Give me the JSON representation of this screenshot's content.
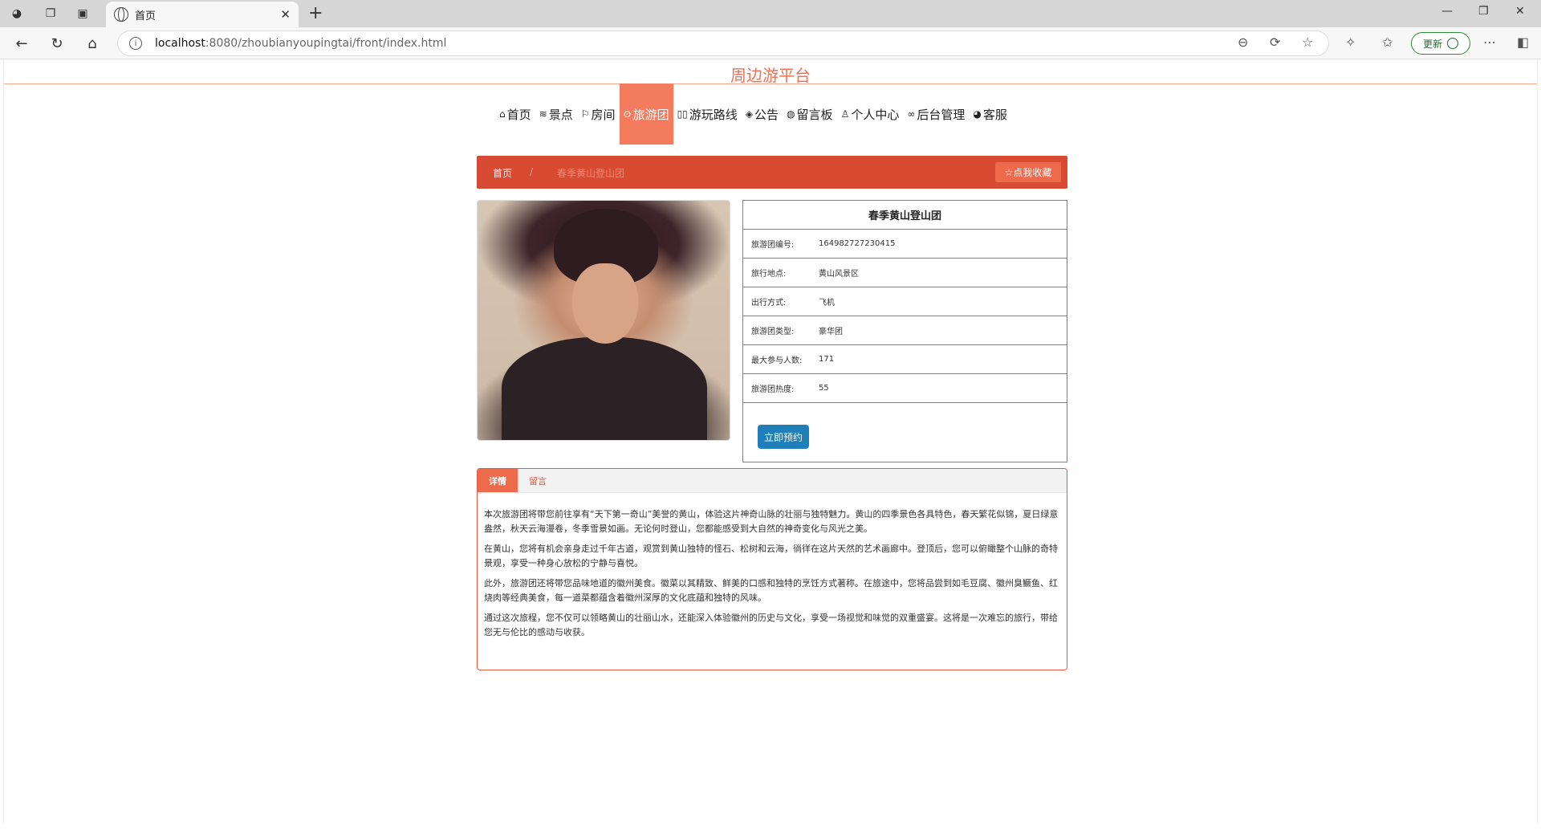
{
  "browser": {
    "tab_title": "首页",
    "url_host": "localhost",
    "url_rest": ":8080/zhoubianyoupingtai/front/index.html",
    "update_label": "更新"
  },
  "site": {
    "title": "周边游平台"
  },
  "nav": {
    "items": [
      {
        "icon": "⌂",
        "label": "首页"
      },
      {
        "icon": "≋",
        "label": "景点"
      },
      {
        "icon": "⚐",
        "label": "房间"
      },
      {
        "icon": "⊙",
        "label": "旅游团"
      },
      {
        "icon": "▯▯",
        "label": "游玩路线"
      },
      {
        "icon": "◈",
        "label": "公告"
      },
      {
        "icon": "◍",
        "label": "留言板"
      },
      {
        "icon": "♙",
        "label": "个人中心"
      },
      {
        "icon": "∞",
        "label": "后台管理"
      },
      {
        "icon": "◕",
        "label": "客服"
      }
    ],
    "active_index": 3
  },
  "breadcrumb": {
    "home": "首页",
    "separator": "/",
    "current": "春季黄山登山团",
    "favorite_label": "☆点我收藏"
  },
  "tour": {
    "title": "春季黄山登山团",
    "fields": [
      {
        "label": "旅游团编号:",
        "value": "164982727230415"
      },
      {
        "label": "旅行地点:",
        "value": "黄山风景区"
      },
      {
        "label": "出行方式:",
        "value": "飞机"
      },
      {
        "label": "旅游团类型:",
        "value": "豪华团"
      },
      {
        "label": "最大参与人数:",
        "value": "171"
      },
      {
        "label": "旅游团热度:",
        "value": "55"
      }
    ],
    "book_label": "立即预约"
  },
  "detail": {
    "tabs": [
      "详情",
      "留言"
    ],
    "paragraphs": [
      "本次旅游团将带您前往享有“天下第一奇山”美誉的黄山，体验这片神奇山脉的壮丽与独特魅力。黄山的四季景色各具特色，春天繁花似锦，夏日绿意盎然，秋天云海漫卷，冬季雪景如画。无论何时登山，您都能感受到大自然的神奇变化与风光之美。",
      "在黄山，您将有机会亲身走过千年古道，观赏到黄山独特的怪石、松树和云海，徜徉在这片天然的艺术画廊中。登顶后，您可以俯瞰整个山脉的奇特景观，享受一种身心放松的宁静与喜悦。",
      "此外，旅游团还将带您品味地道的徽州美食。徽菜以其精致、鲜美的口感和独特的烹饪方式著称。在旅途中，您将品尝到如毛豆腐、徽州臭鳜鱼、红烧肉等经典美食，每一道菜都蕴含着徽州深厚的文化底蕴和独特的风味。",
      "通过这次旅程，您不仅可以领略黄山的壮丽山水，还能深入体验徽州的历史与文化，享受一场视觉和味觉的双重盛宴。这将是一次难忘的旅行，带给您无与伦比的感动与收获。"
    ]
  }
}
